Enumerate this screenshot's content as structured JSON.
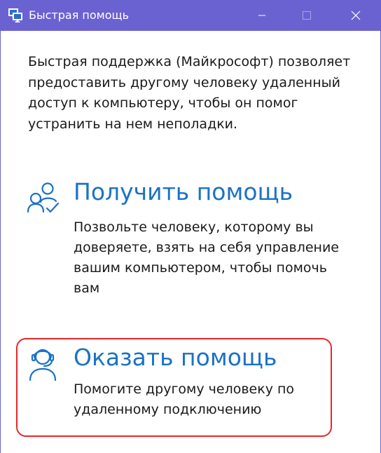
{
  "window": {
    "title": "Быстрая помощь",
    "accent_color": "#6b62d1",
    "controls": {
      "minimize_icon": "minimize-icon",
      "maximize_icon": "maximize-icon",
      "close_icon": "close-icon"
    }
  },
  "intro": {
    "text": "Быстрая поддержка (Майкрософт) позволяет предоставить другому человеку удаленный доступ к компьютеру, чтобы он помог устранить на нем неполадки."
  },
  "options": {
    "get_help": {
      "icon": "people-check-icon",
      "title": "Получить помощь",
      "description": "Позвольте человеку, которому вы доверяете, взять на себя управление вашим компьютером, чтобы помочь вам"
    },
    "give_help": {
      "icon": "headset-person-icon",
      "title": "Оказать помощь",
      "description": "Помогите другому человеку по удаленному подключению",
      "highlight_color": "#e8262b"
    }
  },
  "colors": {
    "link_blue": "#1b72c6",
    "text": "#1a1a1a"
  }
}
